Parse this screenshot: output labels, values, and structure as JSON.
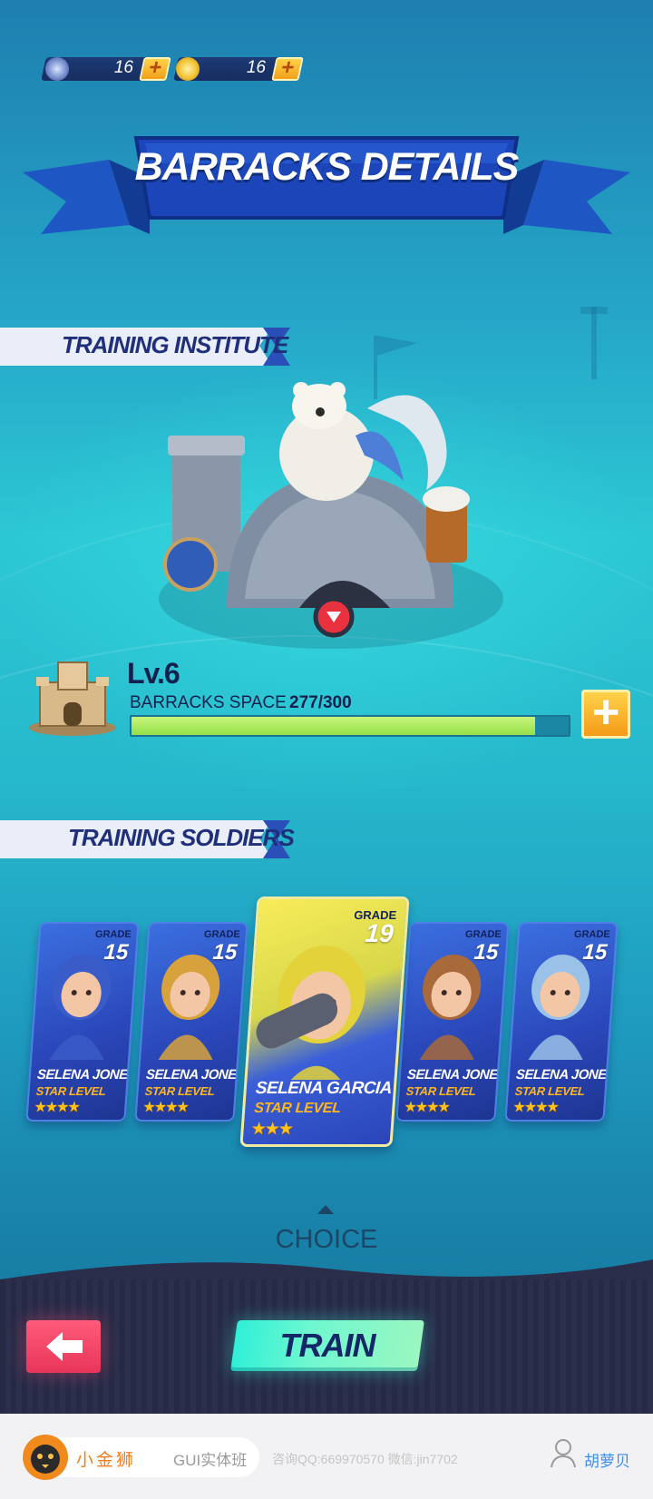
{
  "currencies": [
    {
      "icon": "gem-crystal-icon",
      "value": "16",
      "plus": "+"
    },
    {
      "icon": "gold-coin-icon",
      "value": "16",
      "plus": "+"
    }
  ],
  "title": "BARRACKS DETAILS",
  "sections": {
    "institute": "TRAINING INSTITUTE",
    "soldiers": "TRAINING SOLDIERS"
  },
  "barracks": {
    "level": "Lv.6",
    "space_label": "BARRACKS SPACE",
    "space_value": "277/300",
    "space_fraction": 0.923,
    "add_label": "+"
  },
  "cards": [
    {
      "grade_label": "GRADE",
      "grade": "15",
      "name": "SELENA JONES",
      "star_label": "STAR LEVEL",
      "stars": "★★★★",
      "character": "witch-girl-icon"
    },
    {
      "grade_label": "GRADE",
      "grade": "15",
      "name": "SELENA JONES",
      "star_label": "STAR LEVEL",
      "stars": "★★★★",
      "character": "valkyrie-girl-icon"
    },
    {
      "grade_label": "GRADE",
      "grade": "19",
      "name": "SELENA GARCIA",
      "star_label": "STAR LEVEL",
      "stars": "★★★",
      "character": "bazooka-girl-icon"
    },
    {
      "grade_label": "GRADE",
      "grade": "15",
      "name": "SELENA JONES",
      "star_label": "STAR LEVEL",
      "stars": "★★★★",
      "character": "cowgirl-icon"
    },
    {
      "grade_label": "GRADE",
      "grade": "15",
      "name": "SELENA JONES",
      "star_label": "STAR LEVEL",
      "stars": "★★★★",
      "character": "skeleton-soldier-icon"
    }
  ],
  "choice": "CHOICE",
  "actions": {
    "back_icon": "arrow-left-icon",
    "train": "TRAIN"
  },
  "footer": {
    "brand": "小金狮",
    "tag": "GUI实体班",
    "contact": "咨询QQ:669970570   微信:jin7702",
    "author": "胡萝贝"
  },
  "colors": {
    "accent_orange": "#f59a17",
    "train_cyan": "#2ff0d7",
    "back_pink": "#ff5b79",
    "title_blue": "#1a3fa8"
  }
}
